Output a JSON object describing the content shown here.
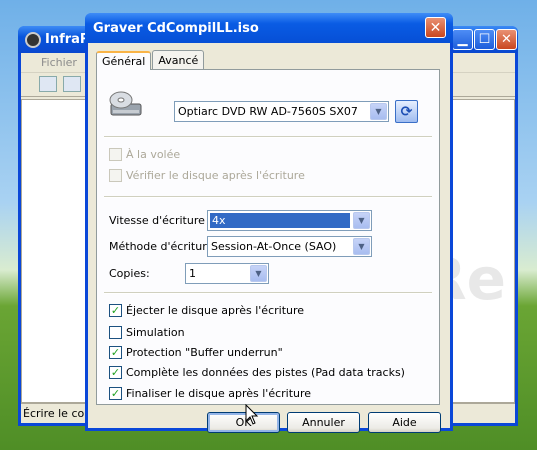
{
  "background_window": {
    "title": "InfraRe",
    "menu": [
      "Fichier"
    ],
    "status": "Écrire le conte",
    "watermark": "InfraRe"
  },
  "dialog": {
    "title": "Graver CdCompilLL.iso",
    "close_label": "✕",
    "tabs": [
      {
        "label": "Général",
        "active": true
      },
      {
        "label": "Avancé",
        "active": false
      }
    ],
    "drive": {
      "value": "Optiarc DVD RW AD-7560S SX07"
    },
    "on_the_fly": {
      "label": "À la volée",
      "checked": false,
      "disabled": true
    },
    "verify": {
      "label": "Vérifier le disque après l'écriture",
      "checked": false,
      "disabled": true
    },
    "write_speed": {
      "label": "Vitesse d'écriture :",
      "value": "4x"
    },
    "write_method": {
      "label": "Méthode d'écriture :",
      "value": "Session-At-Once (SAO)"
    },
    "copies": {
      "label": "Copies:",
      "value": "1"
    },
    "options": [
      {
        "label": "Éjecter le disque après l'écriture",
        "checked": true
      },
      {
        "label": "Simulation",
        "checked": false
      },
      {
        "label": "Protection \"Buffer underrun\"",
        "checked": true
      },
      {
        "label": "Complète les données des pistes (Pad data tracks)",
        "checked": true
      },
      {
        "label": "Finaliser le disque après l'écriture",
        "checked": true
      }
    ],
    "buttons": {
      "ok": "OK",
      "cancel": "Annuler",
      "help": "Aide"
    }
  }
}
